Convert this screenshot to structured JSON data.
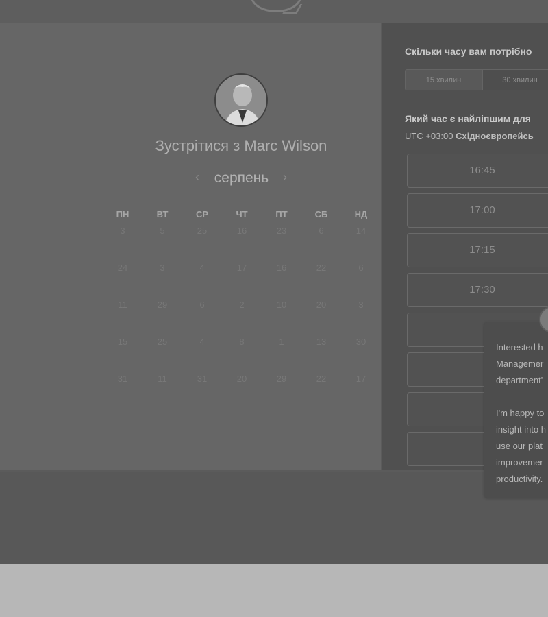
{
  "calendar": {
    "host_title": "Зустрітися з Marc Wilson",
    "month": "серпень",
    "prev_arrow": "‹",
    "next_arrow": "›",
    "weekdays": [
      "ПН",
      "ВТ",
      "СР",
      "ЧТ",
      "ПТ",
      "СБ",
      "НД"
    ],
    "weeks": [
      [
        "3",
        "5",
        "25",
        "16",
        "23",
        "6",
        "14"
      ],
      [
        "24",
        "3",
        "4",
        "17",
        "16",
        "22",
        "6"
      ],
      [
        "11",
        "29",
        "6",
        "2",
        "10",
        "20",
        "3"
      ],
      [
        "15",
        "25",
        "4",
        "8",
        "1",
        "13",
        "30"
      ],
      [
        "31",
        "11",
        "31",
        "20",
        "29",
        "22",
        "17"
      ]
    ]
  },
  "booking": {
    "duration_question": "Скільки часу вам потрібно",
    "durations": [
      "15 хвилин",
      "30 хвилин"
    ],
    "time_question": "Який час є найліпшим для",
    "timezone_offset": "UTC +03:00",
    "timezone_name": "Східноєвропейсь",
    "slots": [
      "16:45",
      "17:00",
      "17:15",
      "17:30",
      "",
      "",
      "",
      ""
    ]
  },
  "chat": {
    "lines": [
      "Interested h",
      "Managemer",
      "department'",
      "",
      "I'm happy to",
      "insight into h",
      "use our plat",
      "improvemer",
      "productivity."
    ]
  },
  "colors": {
    "overlay_background": "#5b5b5b",
    "left_panel": "#666666",
    "right_panel": "#505050",
    "page_background": "#b7b7b7"
  }
}
